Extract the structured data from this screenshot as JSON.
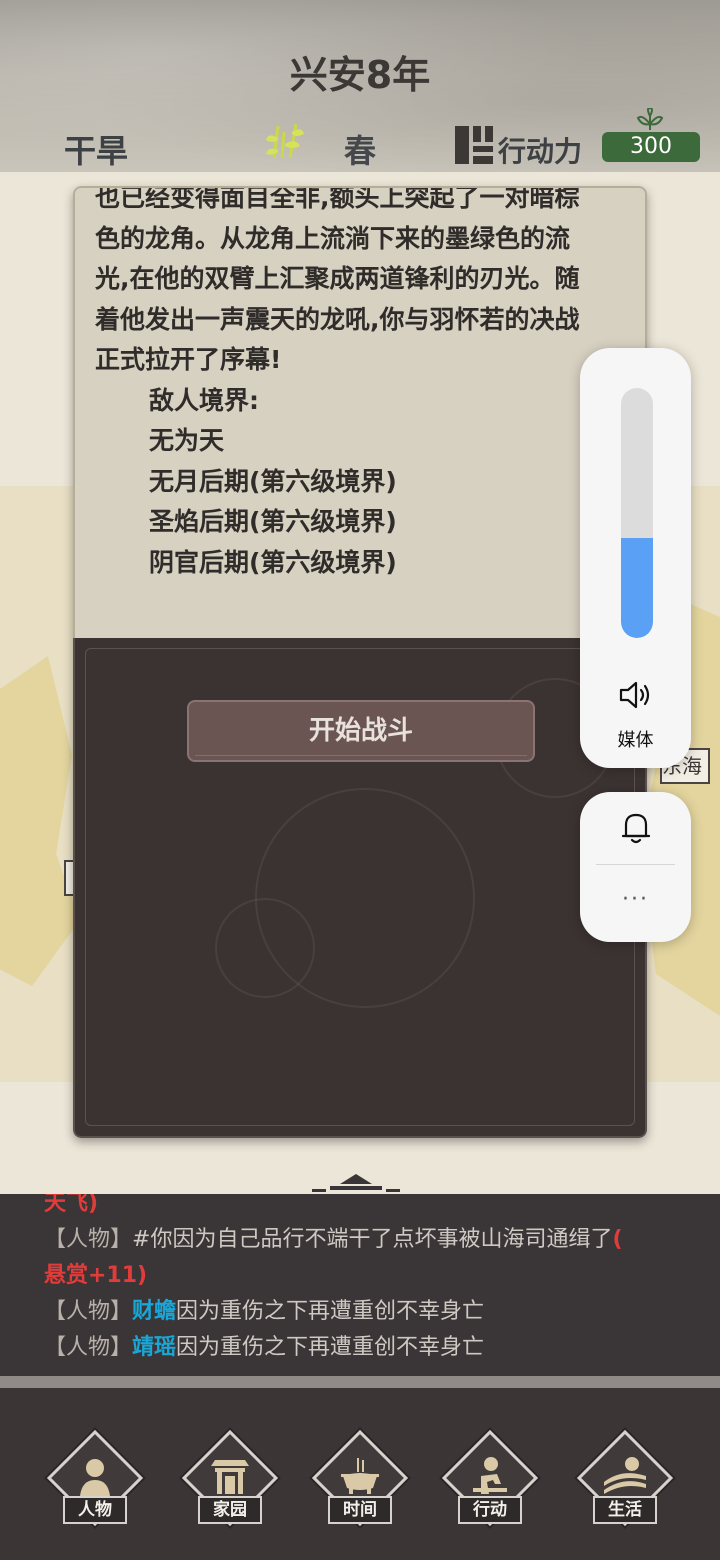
{
  "header": {
    "year_title": "兴安8年",
    "weather": "干旱",
    "season": "春",
    "action_points_label": "行动力",
    "action_points_value": "300"
  },
  "map": {
    "partial_label": "东海"
  },
  "dialog": {
    "story_lines": [
      "也已经变得面目全非,额头上突起了一对暗棕",
      "色的龙角。从龙角上流淌下来的墨绿色的流",
      "光,在他的双臂上汇聚成两道锋利的刃光。随",
      "着他发出一声震天的龙吼,你与羽怀若的决战",
      "正式拉开了序幕!"
    ],
    "enemy_header": "敌人境界:",
    "enemies": [
      "无为天",
      "无月后期(第六级境界)",
      "圣焰后期(第六级境界)",
      "阴官后期(第六级境界)"
    ],
    "start_button": "开始战斗"
  },
  "volume_overlay": {
    "level_percent": 40,
    "label": "媒体",
    "more": "···"
  },
  "log": {
    "line0": {
      "text": "天飞)"
    },
    "line1": {
      "tag": "【人物】",
      "text": "#你因为自己品行不端干了点坏事被山海司通缉了",
      "highlight": "("
    },
    "line2": {
      "text": "悬赏+11)"
    },
    "line3": {
      "tag": "【人物】",
      "name": "财蟾",
      "text": "因为重伤之下再遭重创不幸身亡"
    },
    "line4": {
      "tag": "【人物】",
      "name": "靖瑶",
      "text": "因为重伤之下再遭重创不幸身亡"
    }
  },
  "nav": [
    {
      "label": "人物",
      "icon": "person-icon"
    },
    {
      "label": "家园",
      "icon": "home-gate-icon"
    },
    {
      "label": "时间",
      "icon": "incense-burner-icon"
    },
    {
      "label": "行动",
      "icon": "action-runner-icon"
    },
    {
      "label": "生活",
      "icon": "field-sun-icon"
    }
  ],
  "colors": {
    "accent_green": "#3c6a3a",
    "volume_blue": "#5aa0f5",
    "log_red": "#e23c3a",
    "log_cyan": "#1aa6d6"
  }
}
